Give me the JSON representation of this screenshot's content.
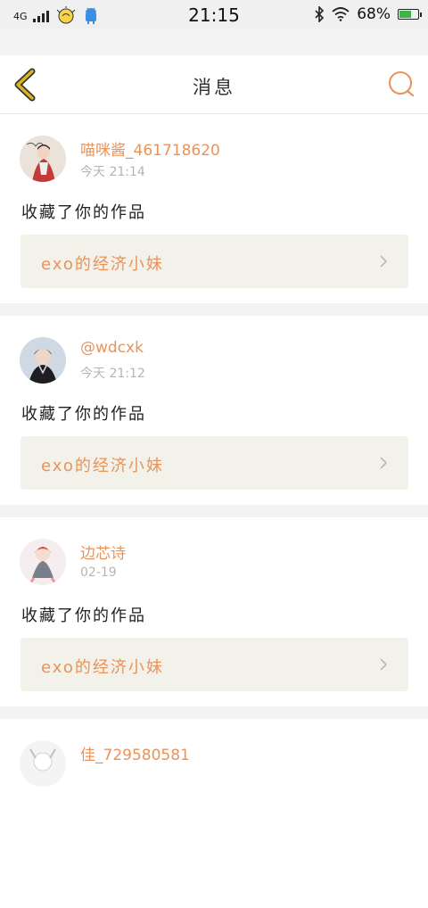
{
  "status_bar": {
    "network": "4G",
    "clock": "21:15",
    "battery_percent": "68%",
    "battery_level": 0.68
  },
  "header": {
    "title": "消息"
  },
  "notifications": [
    {
      "username": "喵咪酱_461718620",
      "time": "今天 21:14",
      "action": "收藏了你的作品",
      "work_title": "exo的经济小妹"
    },
    {
      "username": "@wdcxk",
      "time": "今天 21:12",
      "action": "收藏了你的作品",
      "work_title": "exo的经济小妹"
    },
    {
      "username": "边芯诗",
      "time": "02-19",
      "action": "收藏了你的作品",
      "work_title": "exo的经济小妹"
    },
    {
      "username": "佳_729580581"
    }
  ],
  "colors": {
    "accent": "#e8935a",
    "back_arrow": "#d9b51e",
    "work_bg": "#f3f2ea"
  }
}
